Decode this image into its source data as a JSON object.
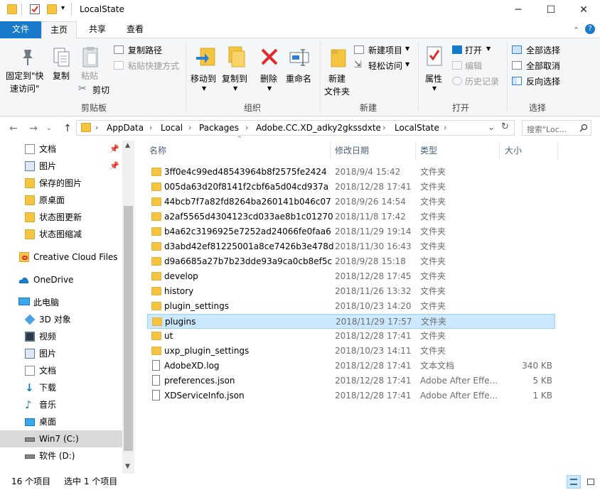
{
  "window": {
    "title": "LocalState",
    "minimize_glyph": "─",
    "maximize_glyph": "☐",
    "close_glyph": "✕"
  },
  "ribbon_tabs": {
    "file": "文件",
    "home": "主页",
    "share": "共享",
    "view": "查看"
  },
  "ribbon": {
    "clipboard": {
      "pin_label_1": "固定到\"快",
      "pin_label_2": "速访问\"",
      "copy": "复制",
      "paste": "粘贴",
      "copy_path": "复制路径",
      "paste_shortcut": "粘贴快捷方式",
      "cut": "剪切",
      "group": "剪贴板"
    },
    "organize": {
      "move_to": "移动到",
      "copy_to": "复制到",
      "delete": "删除",
      "rename": "重命名",
      "group": "组织"
    },
    "new": {
      "new_folder_1": "新建",
      "new_folder_2": "文件夹",
      "new_item": "新建项目",
      "easy_access": "轻松访问",
      "group": "新建"
    },
    "open": {
      "properties": "属性",
      "open": "打开",
      "edit": "编辑",
      "history": "历史记录",
      "group": "打开"
    },
    "select": {
      "select_all": "全部选择",
      "select_none": "全部取消",
      "invert": "反向选择",
      "group": "选择"
    }
  },
  "address": {
    "crumbs": [
      "AppData",
      "Local",
      "Packages",
      "Adobe.CC.XD_adky2gkssdxte",
      "LocalState"
    ],
    "search_placeholder": "搜索\"Loc...",
    "back": "←",
    "forward": "→",
    "up": "↑",
    "refresh": "↻",
    "history": "⌄"
  },
  "sidebar": {
    "items": [
      {
        "label": "文档",
        "icon": "document-icon",
        "pinned": true
      },
      {
        "label": "图片",
        "icon": "pictures-icon",
        "pinned": true
      },
      {
        "label": "保存的图片",
        "icon": "folder-icon"
      },
      {
        "label": "原桌面",
        "icon": "folder-icon"
      },
      {
        "label": "状态图更新",
        "icon": "folder-icon"
      },
      {
        "label": "状态图缩减",
        "icon": "folder-icon"
      },
      {
        "label": "Creative Cloud Files",
        "icon": "creative-cloud-icon"
      },
      {
        "label": "OneDrive",
        "icon": "onedrive-icon"
      },
      {
        "label": "此电脑",
        "icon": "this-pc-icon"
      },
      {
        "label": "3D 对象",
        "icon": "3d-objects-icon"
      },
      {
        "label": "视频",
        "icon": "videos-icon"
      },
      {
        "label": "图片",
        "icon": "pictures-icon"
      },
      {
        "label": "文档",
        "icon": "document-icon"
      },
      {
        "label": "下载",
        "icon": "download-icon"
      },
      {
        "label": "音乐",
        "icon": "music-icon"
      },
      {
        "label": "桌面",
        "icon": "desktop-icon"
      },
      {
        "label": "Win7 (C:)",
        "icon": "drive-icon",
        "selected": true
      },
      {
        "label": "软件 (D:)",
        "icon": "drive-icon"
      }
    ]
  },
  "columns": {
    "name": "名称",
    "date": "修改日期",
    "type": "类型",
    "size": "大小"
  },
  "files": [
    {
      "name": "3ff0e4c99ed48543964b8f2575fe2424",
      "date": "2018/9/4 15:42",
      "type": "文件夹",
      "size": "",
      "kind": "folder"
    },
    {
      "name": "005da63d20f8141f2cbf6a5d04cd937a",
      "date": "2018/12/28 17:41",
      "type": "文件夹",
      "size": "",
      "kind": "folder"
    },
    {
      "name": "44bcb7f7a82fd8264ba260141b046c07",
      "date": "2018/9/26 14:54",
      "type": "文件夹",
      "size": "",
      "kind": "folder"
    },
    {
      "name": "a2af5565d4304123cd033ae8b1c01270",
      "date": "2018/11/8 17:42",
      "type": "文件夹",
      "size": "",
      "kind": "folder"
    },
    {
      "name": "b4a62c3196925e7252ad24066fe0faa6",
      "date": "2018/11/29 19:14",
      "type": "文件夹",
      "size": "",
      "kind": "folder"
    },
    {
      "name": "d3abd42ef81225001a8ce7426b3e478d",
      "date": "2018/11/30 16:43",
      "type": "文件夹",
      "size": "",
      "kind": "folder"
    },
    {
      "name": "d9a6685a27b7b23dde93a9ca0cb8ef5c",
      "date": "2018/9/28 15:18",
      "type": "文件夹",
      "size": "",
      "kind": "folder"
    },
    {
      "name": "develop",
      "date": "2018/12/28 17:45",
      "type": "文件夹",
      "size": "",
      "kind": "folder"
    },
    {
      "name": "history",
      "date": "2018/11/26 13:32",
      "type": "文件夹",
      "size": "",
      "kind": "folder"
    },
    {
      "name": "plugin_settings",
      "date": "2018/10/23 14:20",
      "type": "文件夹",
      "size": "",
      "kind": "folder"
    },
    {
      "name": "plugins",
      "date": "2018/11/29 17:57",
      "type": "文件夹",
      "size": "",
      "kind": "folder",
      "selected": true
    },
    {
      "name": "ut",
      "date": "2018/12/28 17:41",
      "type": "文件夹",
      "size": "",
      "kind": "folder"
    },
    {
      "name": "uxp_plugin_settings",
      "date": "2018/10/23 14:11",
      "type": "文件夹",
      "size": "",
      "kind": "folder"
    },
    {
      "name": "AdobeXD.log",
      "date": "2018/12/28 17:41",
      "type": "文本文档",
      "size": "340 KB",
      "kind": "file"
    },
    {
      "name": "preferences.json",
      "date": "2018/12/28 17:41",
      "type": "Adobe After Effe...",
      "size": "5 KB",
      "kind": "file"
    },
    {
      "name": "XDServiceInfo.json",
      "date": "2018/12/28 17:41",
      "type": "Adobe After Effe...",
      "size": "1 KB",
      "kind": "file"
    }
  ],
  "status": {
    "count": "16 个项目",
    "selected": "选中 1 个项目"
  },
  "colors": {
    "accent": "#1979ca",
    "selection": "#cce8ff",
    "selection_border": "#99d1ff",
    "folder": "#f5c542"
  }
}
